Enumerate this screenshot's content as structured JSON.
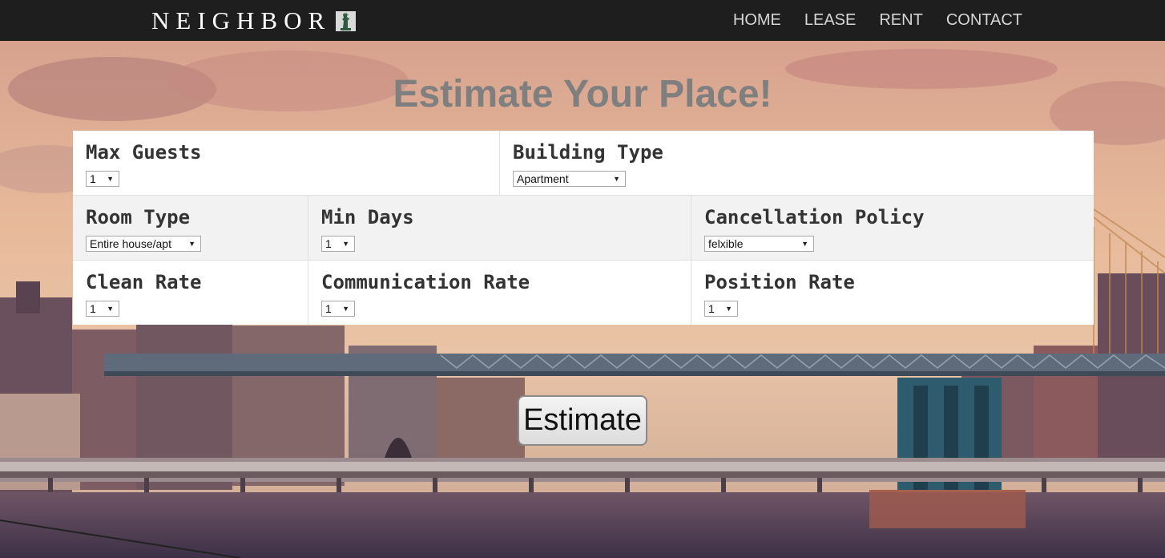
{
  "navbar": {
    "brand": "NEIGHBOR",
    "brand_logo_icon": "statue-of-liberty-icon",
    "links": [
      "HOME",
      "LEASE",
      "RENT",
      "CONTACT"
    ]
  },
  "page": {
    "title": "Estimate Your Place!"
  },
  "form": {
    "max_guests": {
      "label": "Max Guests",
      "value": "1"
    },
    "building_type": {
      "label": "Building Type",
      "value": "Apartment"
    },
    "room_type": {
      "label": "Room Type",
      "value": "Entire house/apt"
    },
    "min_days": {
      "label": "Min Days",
      "value": "1"
    },
    "cancellation_policy": {
      "label": "Cancellation Policy",
      "value": "felxible"
    },
    "clean_rate": {
      "label": "Clean Rate",
      "value": "1"
    },
    "communication_rate": {
      "label": "Communication Rate",
      "value": "1"
    },
    "position_rate": {
      "label": "Position Rate",
      "value": "1"
    }
  },
  "actions": {
    "estimate": "Estimate"
  },
  "colors": {
    "navbar_bg": "#1e1e1e",
    "title_color": "#7f7f7f",
    "row_alt_bg": "#f2f2f2"
  }
}
